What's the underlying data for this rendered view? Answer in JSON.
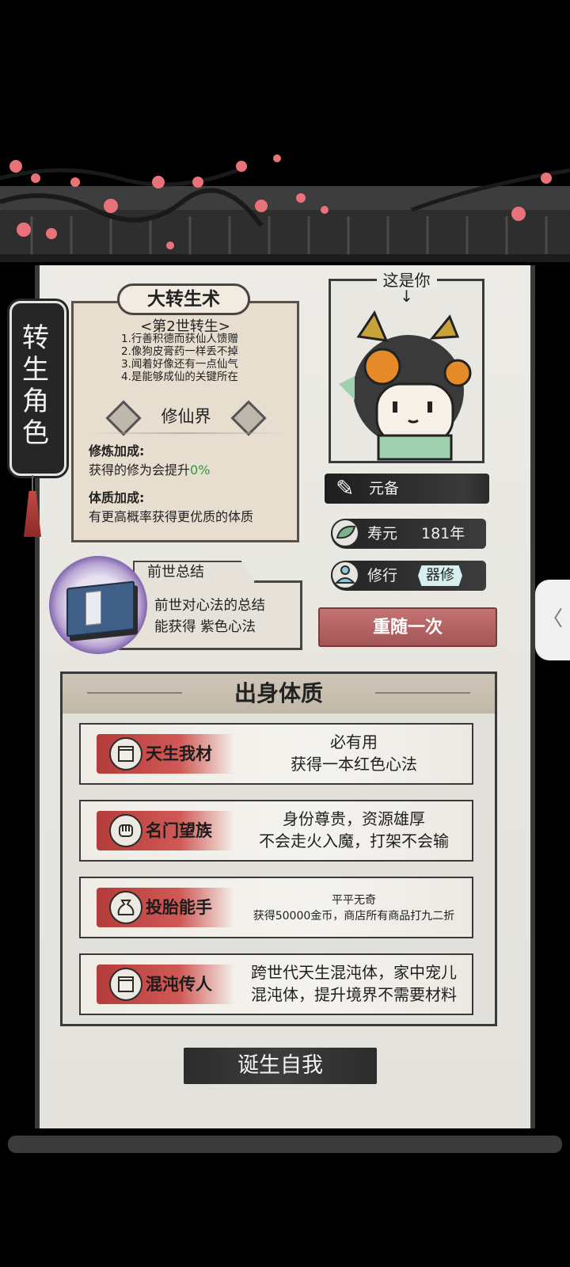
{
  "side_tag": {
    "label": "转生角色"
  },
  "rebirth": {
    "title": "大转生术",
    "subtitle": "<第2世转生>",
    "rules": [
      "1.行善积德而获仙人馈赠",
      "2.像狗皮膏药一样丢不掉",
      "3.闻着好像还有一点仙气",
      "4.是能够成仙的关键所在"
    ],
    "realm": "修仙界",
    "cultivation_bonus_label": "修炼加成:",
    "cultivation_bonus_text": "获得的修为会提升",
    "cultivation_bonus_value": "0%",
    "constitution_bonus_label": "体质加成:",
    "constitution_bonus_text": "有更高概率获得更优质的体质"
  },
  "portrait": {
    "caption": "这是你",
    "arrow": "↓"
  },
  "stats": {
    "name": "元备",
    "lifespan_label": "寿元",
    "lifespan_value": "181年",
    "cultivation_label": "修行",
    "cultivation_value": "器修"
  },
  "reroll_button": "重随一次",
  "previous_life": {
    "tab": "前世总结",
    "line1": "前世对心法的总结",
    "line2": "能获得 紫色心法"
  },
  "origin": {
    "title": "出身体质",
    "traits": [
      {
        "name": "天生我材",
        "desc1": "必有用",
        "desc2": "获得一本红色心法",
        "icon": "scroll-icon"
      },
      {
        "name": "名门望族",
        "desc1": "身份尊贵，资源雄厚",
        "desc2": "不会走火入魔，打架不会输",
        "icon": "fist-icon"
      },
      {
        "name": "投胎能手",
        "desc1": "平平无奇",
        "desc2": "获得50000金币，商店所有商品打九二折",
        "icon": "money-bag-icon"
      },
      {
        "name": "混沌传人",
        "desc1": "跨世代天生混沌体，家中宠儿",
        "desc2": "混沌体，提升境界不需要材料",
        "icon": "scroll-icon"
      }
    ]
  },
  "born_button": "诞生自我",
  "side_handle": "〈",
  "colors": {
    "accent_red": "#c24a45",
    "bonus_green": "#2d9a3a",
    "tag_cyan": "#d7efee",
    "ink": "#2b2b2b"
  }
}
